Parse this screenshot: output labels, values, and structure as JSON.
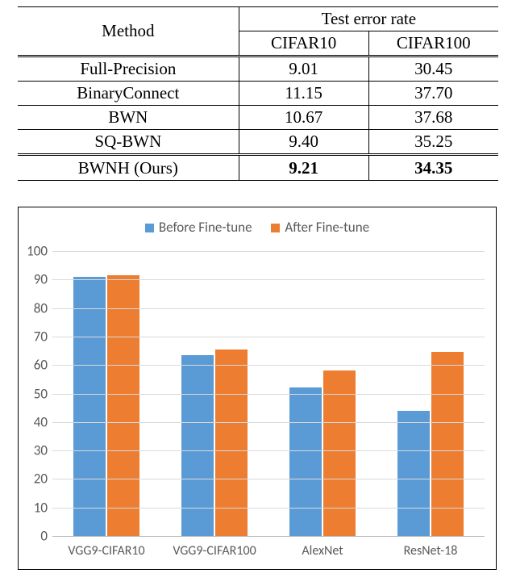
{
  "table": {
    "header": {
      "method": "Method",
      "spanning": "Test error rate",
      "col1": "CIFAR10",
      "col2": "CIFAR100"
    },
    "rows": [
      {
        "method": "Full-Precision",
        "c10": "9.01",
        "c100": "30.45"
      },
      {
        "method": "BinaryConnect",
        "c10": "11.15",
        "c100": "37.70"
      },
      {
        "method": "BWN",
        "c10": "10.67",
        "c100": "37.68"
      },
      {
        "method": "SQ-BWN",
        "c10": "9.40",
        "c100": "35.25"
      }
    ],
    "ours": {
      "method": "BWNH (Ours)",
      "c10": "9.21",
      "c100": "34.35"
    }
  },
  "legend": {
    "before": "Before Fine-tune",
    "after": "After Fine-tune"
  },
  "chart_data": {
    "type": "bar",
    "title": "",
    "xlabel": "",
    "ylabel": "",
    "ylim": [
      0,
      100
    ],
    "yticks": [
      0,
      10,
      20,
      30,
      40,
      50,
      60,
      70,
      80,
      90,
      100
    ],
    "categories": [
      "VGG9-CIFAR10",
      "VGG9-CIFAR100",
      "AlexNet",
      "ResNet-18"
    ],
    "series": [
      {
        "name": "Before Fine-tune",
        "color": "#5B9BD5",
        "values": [
          91,
          63.5,
          52,
          44
        ]
      },
      {
        "name": "After Fine-tune",
        "color": "#ED7D31",
        "values": [
          91.5,
          65.5,
          58,
          64.5
        ]
      }
    ]
  }
}
